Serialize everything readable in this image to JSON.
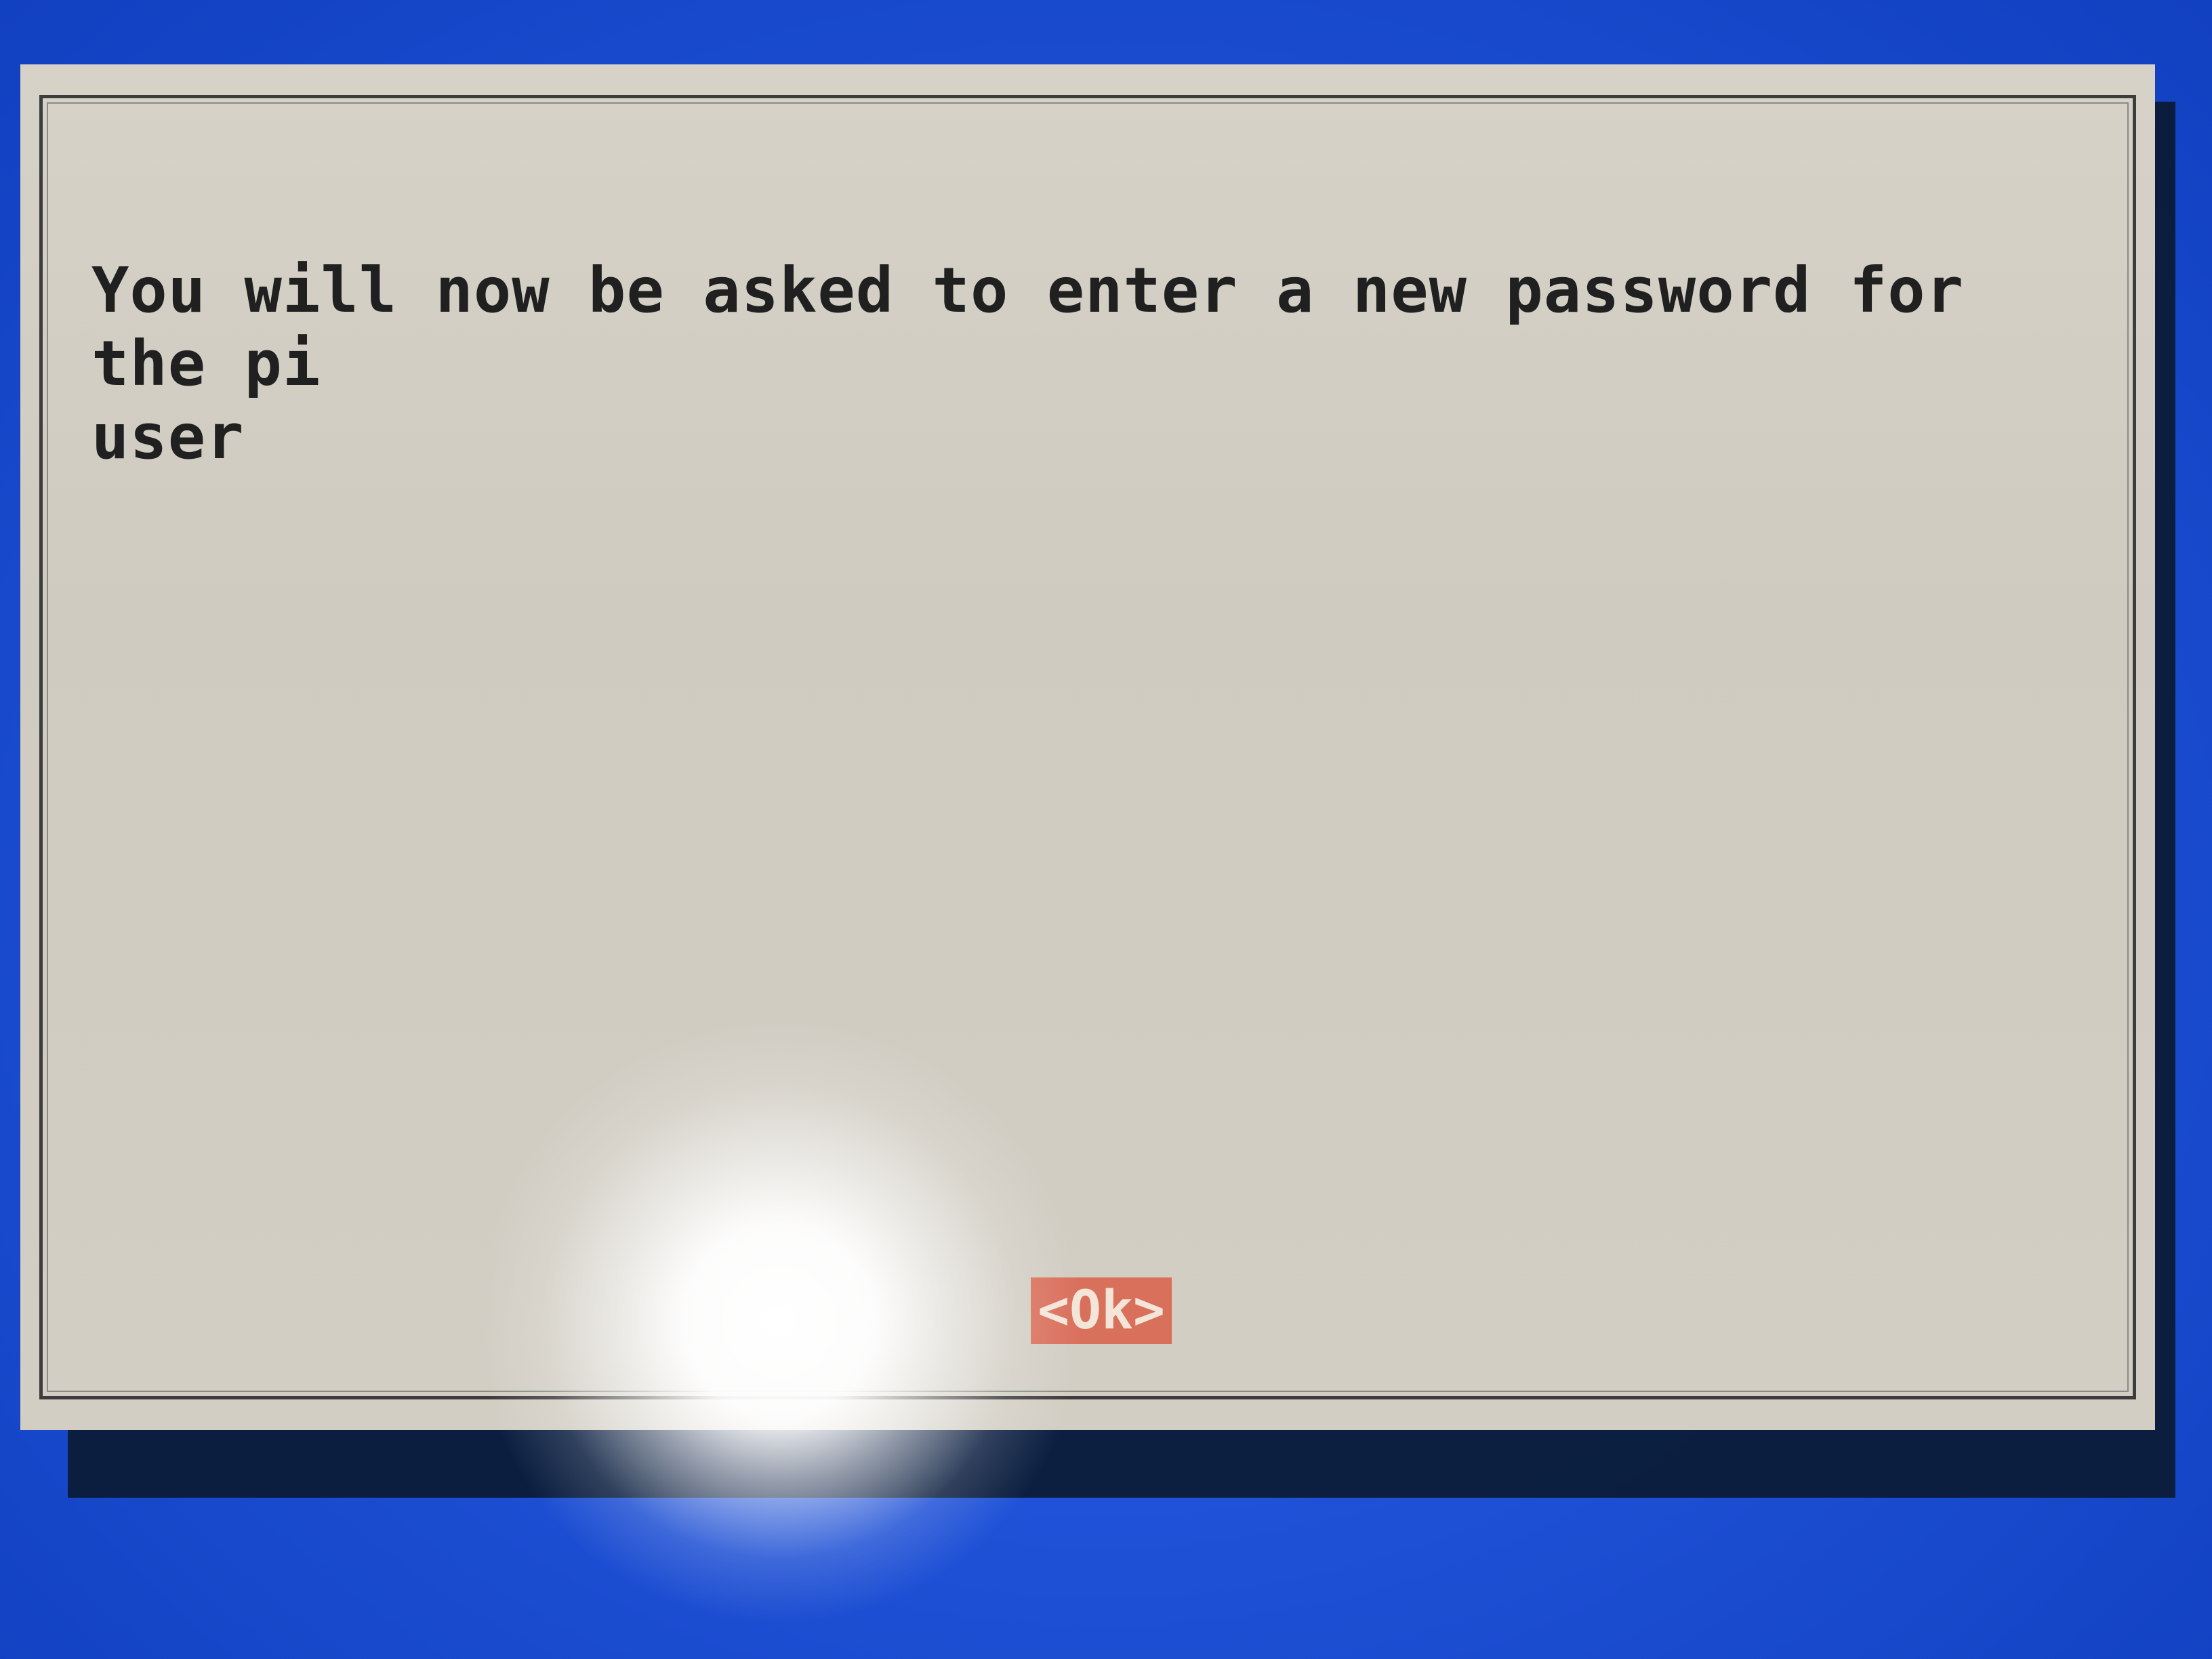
{
  "dialog": {
    "message": "You will now be asked to enter a new password for the pi\nuser",
    "ok_button_label": "<Ok>"
  },
  "colors": {
    "background": "#1f52d8",
    "dialog": "#d2cec4",
    "text": "#202020",
    "button_highlight": "#d9705c"
  }
}
